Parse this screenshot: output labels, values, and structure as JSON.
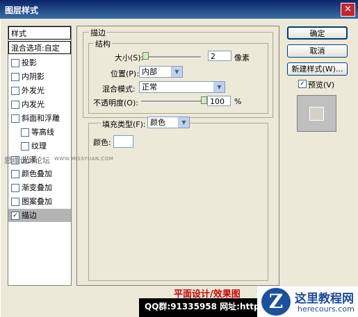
{
  "window": {
    "title": "图层样式",
    "close_glyph": "✕"
  },
  "sidebar": {
    "header": "样式",
    "blend_options": "混合选项:自定",
    "items": [
      {
        "label": "投影",
        "checked": false
      },
      {
        "label": "内阴影",
        "checked": false
      },
      {
        "label": "外发光",
        "checked": false
      },
      {
        "label": "内发光",
        "checked": false
      },
      {
        "label": "斜面和浮雕",
        "checked": false
      },
      {
        "label": "等高线",
        "checked": false
      },
      {
        "label": "纹理",
        "checked": false
      },
      {
        "label": "光泽",
        "checked": false
      },
      {
        "label": "颜色叠加",
        "checked": false
      },
      {
        "label": "渐变叠加",
        "checked": false
      },
      {
        "label": "图案叠加",
        "checked": false
      },
      {
        "label": "描边",
        "checked": true
      }
    ]
  },
  "stroke_panel": {
    "title": "描边",
    "structure": {
      "legend": "结构",
      "size_label": "大小(S):",
      "size_value": "2",
      "size_unit": "像素",
      "position_label": "位置(P):",
      "position_value": "内部",
      "blend_label": "混合模式:",
      "blend_value": "正常",
      "opacity_label": "不透明度(O):",
      "opacity_value": "100",
      "opacity_unit": "%",
      "size_level": 0.02,
      "opacity_level": 1.0
    },
    "fill": {
      "type_label": "填充类型(F):",
      "type_value": "颜色",
      "color_label": "颜色:",
      "color_value": "#ffffff"
    }
  },
  "buttons": {
    "ok": "确定",
    "cancel": "取消",
    "new_style": "新建样式(W)...",
    "preview_label": "预览(V)",
    "preview_checked": true
  },
  "watermarks": {
    "forum": "思缘设计论坛",
    "url": "WWW.MISSYUAN.COM",
    "footer_red": "平面设计/效果图",
    "footer_qq": "QQ群:91335958  网址:http",
    "logo_letter": "Z",
    "logo_title": "这里教程网",
    "logo_sub": "herecours.com"
  },
  "colors": {
    "title_bar": "#0a246a",
    "selected_row": "#b4b4b4",
    "panel_bg": "#ece9d8"
  }
}
